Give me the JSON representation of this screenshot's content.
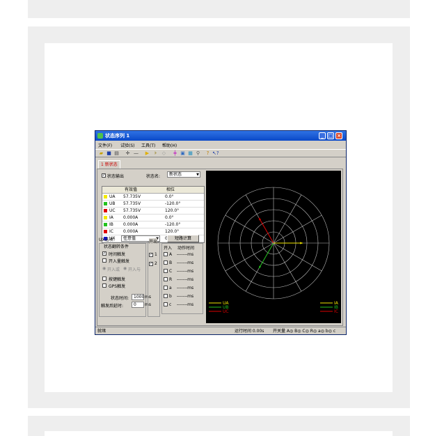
{
  "window": {
    "title": "状态序列 1",
    "controls": [
      "_",
      "□",
      "×"
    ]
  },
  "menu": [
    "文件(F)",
    "试验(S)",
    "工具(T)",
    "帮助(H)"
  ],
  "tab": "1 新状态",
  "state_panel": {
    "output_label": "状态输出",
    "output_checked": true,
    "name_label": "状态名:",
    "name_value": "新状态"
  },
  "grid": {
    "headers": [
      "有效值",
      "相位"
    ],
    "rows": [
      {
        "name": "UA",
        "mag": "57.735V",
        "phase": "0.0°",
        "color": "#f2e900"
      },
      {
        "name": "UB",
        "mag": "57.735V",
        "phase": "-120.0°",
        "color": "#23c21e"
      },
      {
        "name": "UC",
        "mag": "57.735V",
        "phase": "120.0°",
        "color": "#e00000"
      },
      {
        "name": "IA",
        "mag": "0.000A",
        "phase": "0.0°",
        "color": "#f2e900"
      },
      {
        "name": "IB",
        "mag": "0.000A",
        "phase": "-120.0°",
        "color": "#23c21e"
      },
      {
        "name": "IC",
        "mag": "0.000A",
        "phase": "120.0°",
        "color": "#e00000"
      },
      {
        "name": "UX",
        "mag": "0.000V",
        "phase": "0.0°",
        "color": "#1a1ae0"
      }
    ]
  },
  "ux": {
    "label": "UX选项：",
    "value": "任意值",
    "short_button": "短路计算"
  },
  "trigger": {
    "title": "状态翻转条件",
    "time_trigger": "时间触发",
    "time_checked": true,
    "input_trigger": "开入量触发",
    "or_label": "开入或",
    "and_label": "开入与",
    "key_trigger": "按键触发",
    "gps_trigger": "GPS触发",
    "state_time_label": "状态时间:",
    "state_time_value": "1000",
    "unit": "ms",
    "delay_label": "触发后延时:",
    "delay_value": "0"
  },
  "outputs": {
    "title": "开出",
    "items": [
      "1",
      "2"
    ]
  },
  "inputs": {
    "title_in": "开入",
    "title_time": "动作时间",
    "items": [
      {
        "ch": "A",
        "time": "-------ms"
      },
      {
        "ch": "B",
        "time": "-------ms"
      },
      {
        "ch": "C",
        "time": "-------ms"
      },
      {
        "ch": "R",
        "time": "-------ms"
      },
      {
        "ch": "a",
        "time": "-------ms"
      },
      {
        "ch": "b",
        "time": "-------ms"
      },
      {
        "ch": "c",
        "time": "-------ms"
      }
    ]
  },
  "phasor_plot": {
    "left_legend": [
      "UA",
      "UB",
      "UC"
    ],
    "right_legend": [
      "IA",
      "IB",
      "IC"
    ],
    "legend_colors": [
      "#f2e900",
      "#23c21e",
      "#e00000"
    ],
    "vectors": [
      {
        "name": "UA",
        "magnitude": 57.735,
        "angle_deg": 0,
        "color": "#f2e900"
      },
      {
        "name": "UB",
        "magnitude": 57.735,
        "angle_deg": -120,
        "color": "#23c21e"
      },
      {
        "name": "UC",
        "magnitude": 57.735,
        "angle_deg": 120,
        "color": "#e00000"
      }
    ]
  },
  "status": {
    "left": "就绪",
    "runtime": "运行时间 0.00s",
    "switches": "开关量 A◎ B◎ C◎ R◎ a◎ b◎ c"
  }
}
